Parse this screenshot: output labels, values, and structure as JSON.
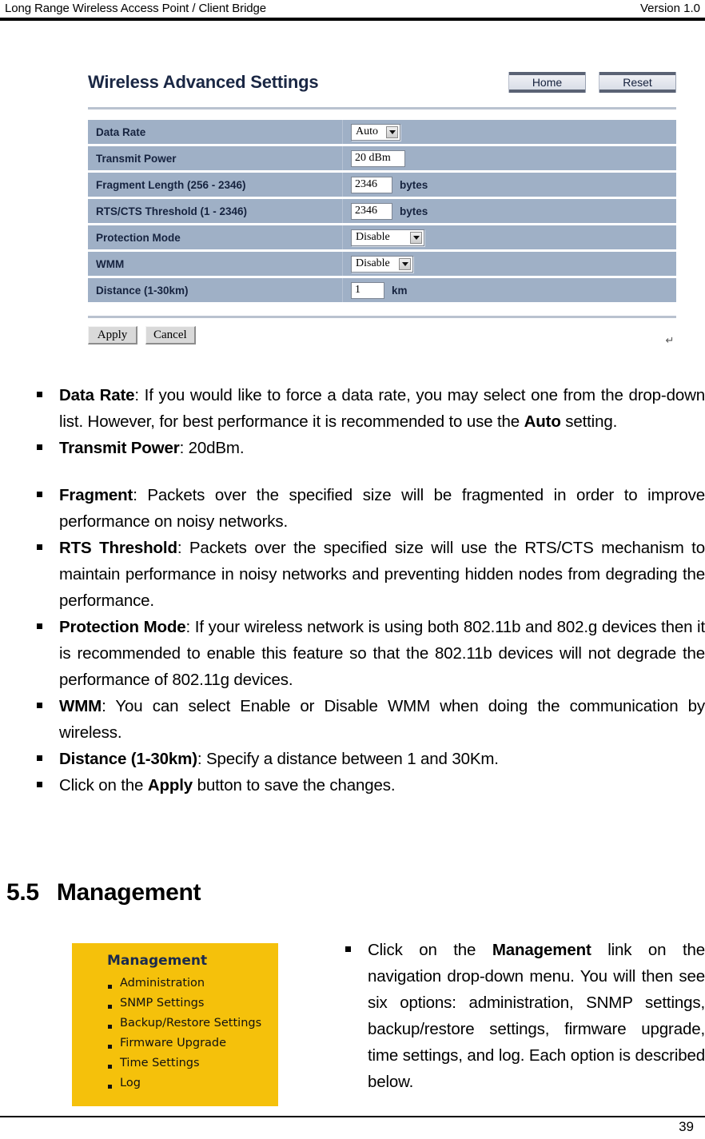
{
  "header": {
    "title": "Long Range Wireless Access Point / Client Bridge",
    "version": "Version 1.0"
  },
  "wireless_figure": {
    "panel_title": "Wireless Advanced Settings",
    "home_button": "Home",
    "reset_button": "Reset",
    "rows": [
      {
        "label": "Data Rate",
        "control": "select",
        "value": "Auto",
        "unit": ""
      },
      {
        "label": "Transmit Power",
        "control": "text",
        "value": "20 dBm",
        "unit": ""
      },
      {
        "label": "Fragment Length (256 - 2346)",
        "control": "text",
        "value": "2346",
        "unit": "bytes"
      },
      {
        "label": "RTS/CTS Threshold (1 - 2346)",
        "control": "text",
        "value": "2346",
        "unit": "bytes"
      },
      {
        "label": "Protection Mode",
        "control": "select",
        "value": "Disable",
        "unit": ""
      },
      {
        "label": "WMM",
        "control": "select",
        "value": "Disable",
        "unit": ""
      },
      {
        "label": "Distance (1-30km)",
        "control": "text",
        "value": "1",
        "unit": "km"
      }
    ],
    "apply_button": "Apply",
    "cancel_button": "Cancel",
    "paragraph_mark": "↵"
  },
  "descriptions": [
    {
      "term": "Data Rate",
      "rest": ": If you would like to force a data rate, you may select one from the drop-down list. However, for best performance it is recommended to use the ",
      "emphasis": "Auto",
      "tail": " setting."
    },
    {
      "term": "Transmit Power",
      "rest": ": 20dBm.",
      "emphasis": "",
      "tail": ""
    },
    {
      "term": "Fragment",
      "rest": ": Packets over the specified size will be fragmented in order to improve performance on noisy networks.",
      "emphasis": "",
      "tail": ""
    },
    {
      "term": "RTS Threshold",
      "rest": ": Packets over the specified size will use the RTS/CTS mechanism to maintain performance in noisy networks and preventing hidden nodes from degrading the performance.",
      "emphasis": "",
      "tail": ""
    },
    {
      "term": "Protection Mode",
      "rest": ": If your wireless network is using both 802.11b and 802.g devices then it is recommended to enable this feature so that the 802.11b devices will not degrade the performance of 802.11g devices.",
      "emphasis": "",
      "tail": ""
    },
    {
      "term": "WMM",
      "rest": ": You can select Enable or Disable WMM when doing the communication by wireless.",
      "emphasis": "",
      "tail": ""
    },
    {
      "term": "Distance (1-30km)",
      "rest": ": Specify a distance between 1 and 30Km.",
      "emphasis": "",
      "tail": ""
    },
    {
      "term": "",
      "rest": "Click on the ",
      "emphasis": "Apply",
      "tail": " button to save the changes."
    }
  ],
  "section": {
    "number": "5.5",
    "title": "Management"
  },
  "management_figure": {
    "title": "Management",
    "items": [
      "Administration",
      "SNMP Settings",
      "Backup/Restore Settings",
      "Firmware Upgrade",
      "Time Settings",
      "Log"
    ]
  },
  "management_paragraph": {
    "lead": "Click on the ",
    "emphasis": "Management",
    "tail": " link on the navigation drop-down menu. You will then see six options: administration, SNMP settings, backup/restore settings, firmware upgrade, time settings, and log. Each option is described below."
  },
  "footer": {
    "page_number": "39"
  }
}
